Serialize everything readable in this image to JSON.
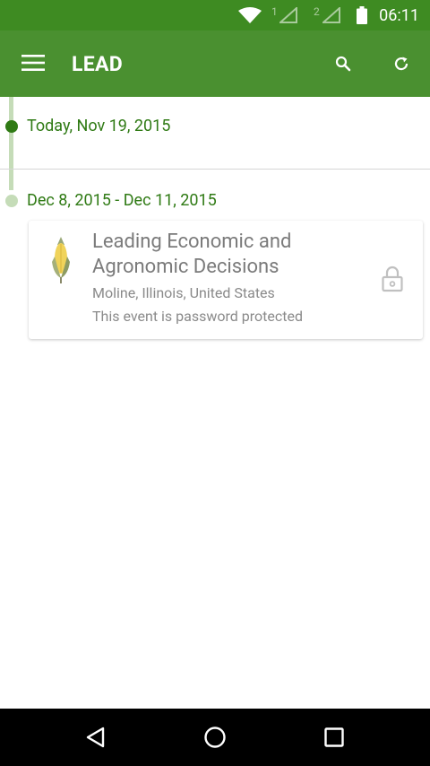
{
  "status_bar": {
    "time": "06:11",
    "sim1_label": "1",
    "sim2_label": "2",
    "icons": [
      "wifi-icon",
      "signal-icon",
      "signal-icon",
      "battery-icon"
    ]
  },
  "app_bar": {
    "title": "LEAD",
    "icons": [
      "menu-icon",
      "search-icon",
      "refresh-icon"
    ]
  },
  "timeline": {
    "today": {
      "label": "Today, Nov 19, 2015"
    },
    "groups": [
      {
        "date_range": "Dec 8, 2015 - Dec 11, 2015",
        "events": [
          {
            "name": "Leading Economic and Agronomic Decisions",
            "location": "Moline, Illinois, United States",
            "note": "This event is password protected",
            "icons": [
              "corn-logo-icon",
              "lock-icon"
            ]
          }
        ]
      }
    ]
  },
  "colors": {
    "status_bar": "#3e8b22",
    "app_bar": "#4a9030",
    "accent": "#2f7a14",
    "timeline_faded": "#c5dcb8"
  },
  "nav_bar": {
    "icons": [
      "back-icon",
      "home-icon",
      "recents-icon"
    ]
  }
}
